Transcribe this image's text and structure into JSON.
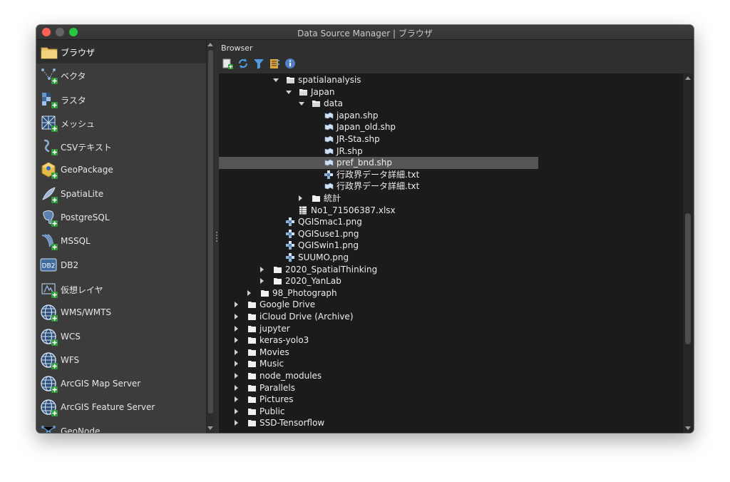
{
  "window": {
    "title": "Data Source Manager | ブラウザ"
  },
  "sidebar": {
    "items": [
      {
        "label": "ブラウザ",
        "icon": "folder-icon",
        "active": true
      },
      {
        "label": "ベクタ",
        "icon": "vector-layer-icon"
      },
      {
        "label": "ラスタ",
        "icon": "raster-layer-icon"
      },
      {
        "label": "メッシュ",
        "icon": "mesh-layer-icon"
      },
      {
        "label": "CSVテキスト",
        "icon": "csv-layer-icon"
      },
      {
        "label": "GeoPackage",
        "icon": "geopackage-icon"
      },
      {
        "label": "SpatiaLite",
        "icon": "spatialite-icon"
      },
      {
        "label": "PostgreSQL",
        "icon": "postgresql-icon"
      },
      {
        "label": "MSSQL",
        "icon": "mssql-icon"
      },
      {
        "label": "DB2",
        "icon": "db2-icon"
      },
      {
        "label": "仮想レイヤ",
        "icon": "virtual-layer-icon"
      },
      {
        "label": "WMS/WMTS",
        "icon": "wms-globe-icon"
      },
      {
        "label": "WCS",
        "icon": "wcs-globe-icon"
      },
      {
        "label": "WFS",
        "icon": "wfs-globe-icon"
      },
      {
        "label": "ArcGIS Map Server",
        "icon": "arcgis-map-globe-icon"
      },
      {
        "label": "ArcGIS Feature Server",
        "icon": "arcgis-feature-globe-icon"
      },
      {
        "label": "GeoNode",
        "icon": "geonode-icon"
      }
    ]
  },
  "browser": {
    "title": "Browser",
    "toolbar": [
      "add-selected-icon",
      "refresh-icon",
      "filter-icon",
      "collapse-all-icon",
      "info-icon"
    ],
    "rows": [
      {
        "label": "spatialanalysis",
        "depth": 4,
        "type": "folder-open",
        "expander": "open"
      },
      {
        "label": "Japan",
        "depth": 5,
        "type": "folder-open",
        "expander": "open"
      },
      {
        "label": "data",
        "depth": 6,
        "type": "folder-open",
        "expander": "open"
      },
      {
        "label": "japan.shp",
        "depth": 7,
        "type": "polygon-layer"
      },
      {
        "label": "Japan_old.shp",
        "depth": 7,
        "type": "polygon-layer"
      },
      {
        "label": "JR-Sta.shp",
        "depth": 7,
        "type": "polygon-layer"
      },
      {
        "label": "JR.shp",
        "depth": 7,
        "type": "polygon-layer"
      },
      {
        "label": "pref_bnd.shp",
        "depth": 7,
        "type": "polygon-layer",
        "selected": true
      },
      {
        "label": "行政界データ詳細.txt",
        "depth": 7,
        "type": "raster-layer"
      },
      {
        "label": "行政界データ詳細.txt",
        "depth": 7,
        "type": "polygon-layer"
      },
      {
        "label": "統計",
        "depth": 6,
        "type": "folder",
        "expander": "closed"
      },
      {
        "label": "No1_71506387.xlsx",
        "depth": 5,
        "type": "table"
      },
      {
        "label": "QGISmac1.png",
        "depth": 4,
        "type": "raster-layer"
      },
      {
        "label": "QGISuse1.png",
        "depth": 4,
        "type": "raster-layer"
      },
      {
        "label": "QGISwin1.png",
        "depth": 4,
        "type": "raster-layer"
      },
      {
        "label": "SUUMO.png",
        "depth": 4,
        "type": "raster-layer"
      },
      {
        "label": "2020_SpatialThinking",
        "depth": 3,
        "type": "folder",
        "expander": "closed"
      },
      {
        "label": "2020_YanLab",
        "depth": 3,
        "type": "folder",
        "expander": "closed"
      },
      {
        "label": "98_Photograph",
        "depth": 2,
        "type": "folder",
        "expander": "closed"
      },
      {
        "label": "Google Drive",
        "depth": 1,
        "type": "folder",
        "expander": "closed"
      },
      {
        "label": "iCloud Drive (Archive)",
        "depth": 1,
        "type": "folder",
        "expander": "closed"
      },
      {
        "label": "jupyter",
        "depth": 1,
        "type": "folder",
        "expander": "closed"
      },
      {
        "label": "keras-yolo3",
        "depth": 1,
        "type": "folder",
        "expander": "closed"
      },
      {
        "label": "Movies",
        "depth": 1,
        "type": "folder",
        "expander": "closed"
      },
      {
        "label": "Music",
        "depth": 1,
        "type": "folder",
        "expander": "closed"
      },
      {
        "label": "node_modules",
        "depth": 1,
        "type": "folder",
        "expander": "closed"
      },
      {
        "label": "Parallels",
        "depth": 1,
        "type": "folder",
        "expander": "closed"
      },
      {
        "label": "Pictures",
        "depth": 1,
        "type": "folder",
        "expander": "closed"
      },
      {
        "label": "Public",
        "depth": 1,
        "type": "folder",
        "expander": "closed"
      },
      {
        "label": "SSD-Tensorflow",
        "depth": 1,
        "type": "folder",
        "expander": "closed"
      }
    ]
  }
}
